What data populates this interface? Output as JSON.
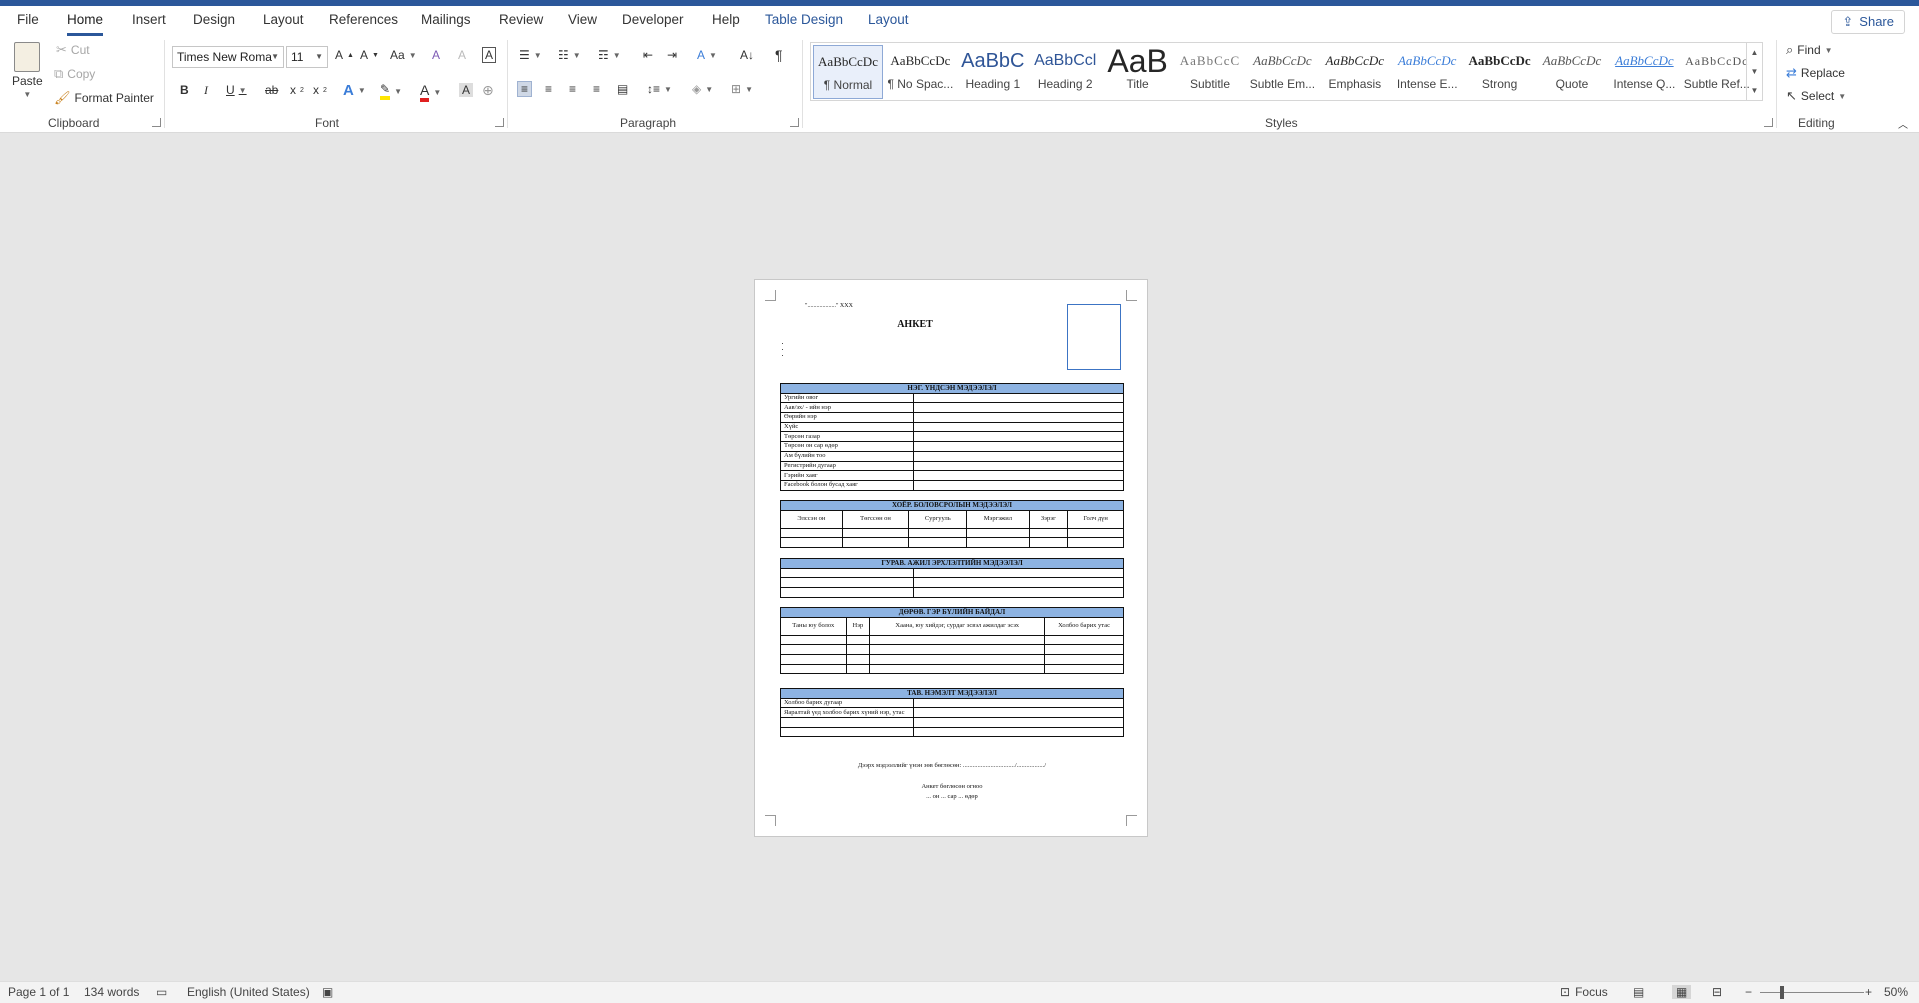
{
  "tabs": {
    "file": "File",
    "home": "Home",
    "insert": "Insert",
    "design": "Design",
    "layout": "Layout",
    "references": "References",
    "mailings": "Mailings",
    "review": "Review",
    "view": "View",
    "developer": "Developer",
    "help": "Help",
    "table_design": "Table Design",
    "table_layout": "Layout"
  },
  "share_label": "Share",
  "clipboard": {
    "paste": "Paste",
    "cut": "Cut",
    "copy": "Copy",
    "format_painter": "Format Painter",
    "group": "Clipboard"
  },
  "font": {
    "name": "Times New Roma",
    "size": "11",
    "group": "Font"
  },
  "paragraph": {
    "group": "Paragraph"
  },
  "styles": {
    "group": "Styles",
    "items": [
      {
        "preview": "AaBbCcDc",
        "name": "¶ Normal"
      },
      {
        "preview": "AaBbCcDc",
        "name": "¶ No Spac..."
      },
      {
        "preview": "AaBbC",
        "name": "Heading 1"
      },
      {
        "preview": "AaBbCcl",
        "name": "Heading 2"
      },
      {
        "preview": "AaB",
        "name": "Title"
      },
      {
        "preview": "AaBbCcC",
        "name": "Subtitle"
      },
      {
        "preview": "AaBbCcDc",
        "name": "Subtle Em..."
      },
      {
        "preview": "AaBbCcDc",
        "name": "Emphasis"
      },
      {
        "preview": "AaBbCcDc",
        "name": "Intense E..."
      },
      {
        "preview": "AaBbCcDc",
        "name": "Strong"
      },
      {
        "preview": "AaBbCcDc",
        "name": "Quote"
      },
      {
        "preview": "AaBbCcDc",
        "name": "Intense Q..."
      },
      {
        "preview": "AaBbCcDc",
        "name": "Subtle Ref..."
      }
    ]
  },
  "editing": {
    "find": "Find",
    "replace": "Replace",
    "select": "Select",
    "group": "Editing"
  },
  "document": {
    "date_line": "\"...................\" ХХХ",
    "title": "АНКЕТ",
    "sections": {
      "s1": {
        "header": "НЭГ. ҮНДСЭН МЭДЭЭЛЭЛ",
        "rows": [
          "Ургийн овог",
          "Аав/эх/ - ийн нэр",
          "Өөрийн нэр",
          "Хүйс",
          "Төрсөн газар",
          "Төрсөн он сар өдөр",
          "Ам бүлийн тоо",
          "Регистрийн дугаар",
          "Гэрийн хаяг",
          "Facebook болон бусад хаяг"
        ]
      },
      "s2": {
        "header": "ХОЁР. БОЛОВСРОЛЫН МЭДЭЭЛЭЛ",
        "cols": [
          "Элссэн он",
          "Төгссөн он",
          "Сургууль",
          "Мэргэжил",
          "Зэрэг",
          "Голч дүн"
        ]
      },
      "s3": {
        "header": "ГУРАВ. АЖИЛ ЭРХЛЭЛТИЙН МЭДЭЭЛЭЛ"
      },
      "s4": {
        "header": "ДӨРӨВ. ГЭР БҮЛИЙН БАЙДАЛ",
        "cols": [
          "Таны юу болох",
          "Нэр",
          "Хаана, юу хийдэг, сурдаг эсвэл ажилдаг эсэх",
          "Холбоо барих утас"
        ]
      },
      "s5": {
        "header": "ТАВ. НЭМЭЛТ МЭДЭЭЛЭЛ",
        "rows": [
          "Холбоо барих дугаар",
          "Яаралтай үед холбоо барих хүний нэр, утас"
        ]
      }
    },
    "signature_line": "Дээрх мэдээллийг үнэн зөв бөглөсөн: ................................/................./",
    "filled_line": "Анкет бөглөсөн огноо",
    "date_fill": "... он ... сар ... өдөр"
  },
  "status": {
    "page": "Page 1 of 1",
    "words": "134 words",
    "language": "English (United States)",
    "focus": "Focus",
    "zoom": "50%"
  },
  "accent_color": "#2b579a",
  "table_header_color": "#8db3e2"
}
